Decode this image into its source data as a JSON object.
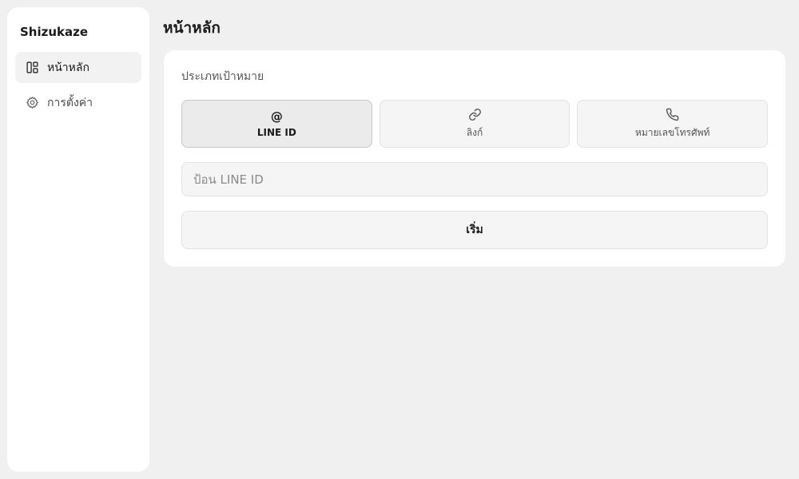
{
  "sidebar": {
    "brand": "Shizukaze",
    "items": [
      {
        "label": "หน้าหลัก",
        "icon": "layout-icon",
        "active": true
      },
      {
        "label": "การตั้งค่า",
        "icon": "gear-icon",
        "active": false
      }
    ]
  },
  "main": {
    "title": "หน้าหลัก",
    "target_type_label": "ประเภทเป้าหมาย",
    "target_types": [
      {
        "label": "LINE ID",
        "icon": "at-icon",
        "selected": true
      },
      {
        "label": "ลิงก์",
        "icon": "link-icon",
        "selected": false
      },
      {
        "label": "หมายเลขโทรศัพท์",
        "icon": "phone-icon",
        "selected": false
      }
    ],
    "input": {
      "placeholder": "ป้อน LINE ID",
      "value": ""
    },
    "start_label": "เริ่ม"
  }
}
